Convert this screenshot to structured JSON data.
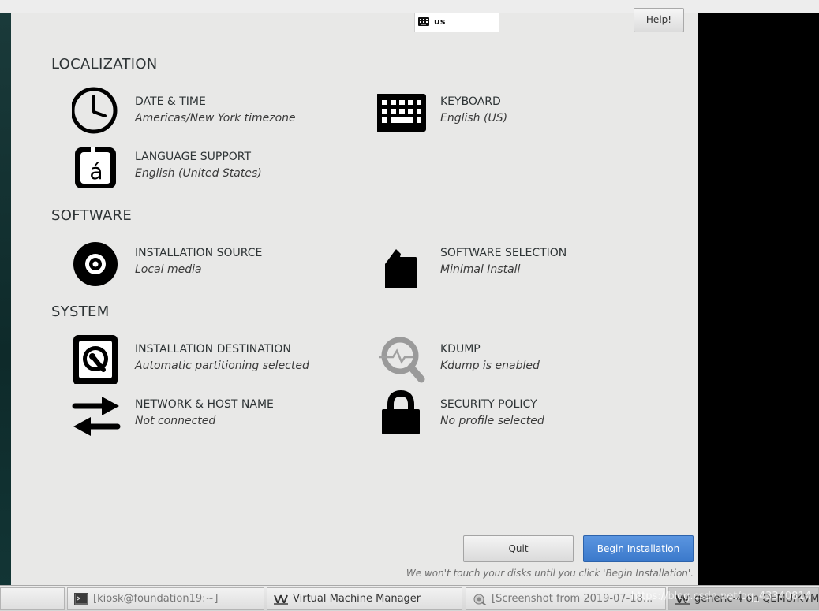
{
  "keyboard_indicator": {
    "layout": "us",
    "icon": "keyboard-icon"
  },
  "help_button": {
    "label": "Help!"
  },
  "sections": {
    "localization": "LOCALIZATION",
    "software": "SOFTWARE",
    "system": "SYSTEM"
  },
  "spokes": {
    "date_time": {
      "title": "DATE & TIME",
      "status": "Americas/New York timezone",
      "icon": "clock-icon"
    },
    "keyboard": {
      "title": "KEYBOARD",
      "status": "English (US)",
      "icon": "keyboard-icon"
    },
    "language": {
      "title": "LANGUAGE SUPPORT",
      "status": "English (United States)",
      "icon": "language-icon"
    },
    "install_source": {
      "title": "INSTALLATION SOURCE",
      "status": "Local media",
      "icon": "disc-icon"
    },
    "software_selection": {
      "title": "SOFTWARE SELECTION",
      "status": "Minimal Install",
      "icon": "package-icon"
    },
    "install_destination": {
      "title": "INSTALLATION DESTINATION",
      "status": "Automatic partitioning selected",
      "icon": "hard-disk-icon"
    },
    "kdump": {
      "title": "KDUMP",
      "status": "Kdump is enabled",
      "icon": "magnifier-icon"
    },
    "network": {
      "title": "NETWORK & HOST NAME",
      "status": "Not connected",
      "icon": "network-arrows-icon"
    },
    "security": {
      "title": "SECURITY POLICY",
      "status": "No profile selected",
      "icon": "padlock-icon"
    }
  },
  "actions": {
    "quit": "Quit",
    "begin": "Begin Installation",
    "note": "We won't touch your disks until you click 'Begin Installation'."
  },
  "taskbar": {
    "items": [
      {
        "label": "",
        "icon": "show-desktop-icon"
      },
      {
        "label": "[kiosk@foundation19:~]",
        "icon": "terminal-icon"
      },
      {
        "label": "Virtual Machine Manager",
        "icon": "virt-manager-icon"
      },
      {
        "label": "[Screenshot from 2019-07-18...",
        "icon": "screenshot-icon"
      },
      {
        "label": "generic-4 on QEMU/KVM",
        "icon": "virt-manager-icon"
      }
    ],
    "watermark": "https://blog.csdn.net/qq_43340814"
  },
  "colors": {
    "installer_bg": "#e8e8e7",
    "primary_button": "#3b79cb",
    "text": "#2e3436"
  }
}
